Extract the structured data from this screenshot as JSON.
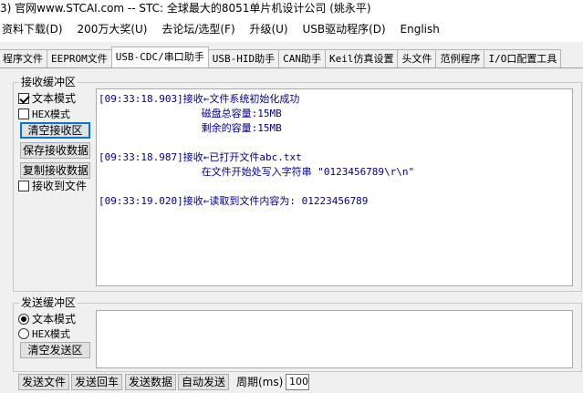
{
  "window": {
    "title": "3) 官网www.STCAI.com  -- STC: 全球最大的8051单片机设计公司 (姚永平)"
  },
  "menu": [
    "资料下载(D)",
    "200万大奖(U)",
    "去论坛/选型(F)",
    "升级(U)",
    "USB驱动程序(D)",
    "English"
  ],
  "tabs": [
    {
      "label": "程序文件",
      "active": false
    },
    {
      "label": "EEPROM文件",
      "active": false
    },
    {
      "label": "USB-CDC/串口助手",
      "active": true
    },
    {
      "label": "USB-HID助手",
      "active": false
    },
    {
      "label": "CAN助手",
      "active": false
    },
    {
      "label": "Keil仿真设置",
      "active": false
    },
    {
      "label": "头文件",
      "active": false
    },
    {
      "label": "范例程序",
      "active": false
    },
    {
      "label": "I/O口配置工具",
      "active": false
    }
  ],
  "receive": {
    "group_label": "接收缓冲区",
    "text_mode_label": "文本模式",
    "text_mode_checked": true,
    "hex_mode_label": "HEX模式",
    "hex_mode_checked": false,
    "clear_button": "清空接收区",
    "save_button": "保存接收数据",
    "copy_button": "复制接收数据",
    "to_file_label": "接收到文件",
    "to_file_checked": false,
    "log": [
      "[09:33:18.903]接收←文件系统初始化成功",
      "                 磁盘总容量:15MB",
      "                 剩余的容量:15MB",
      "[09:33:18.987]接收←已打开文件abc.txt",
      "                 在文件开始处写入字符串 \"0123456789\\r\\n\"",
      "[09:33:19.020]接收←读取到文件内容为: 01223456789"
    ]
  },
  "send": {
    "group_label": "发送缓冲区",
    "text_mode_label": "文本模式",
    "text_mode_checked": true,
    "hex_mode_label": "HEX模式",
    "hex_mode_checked": false,
    "clear_button": "清空发送区",
    "value": ""
  },
  "bottom": {
    "send_file_button": "发送文件",
    "send_enter_button": "发送回车",
    "send_data_button": "发送数据",
    "auto_send_button": "自动发送",
    "period_label": "周期(ms)",
    "period_value": "100"
  }
}
